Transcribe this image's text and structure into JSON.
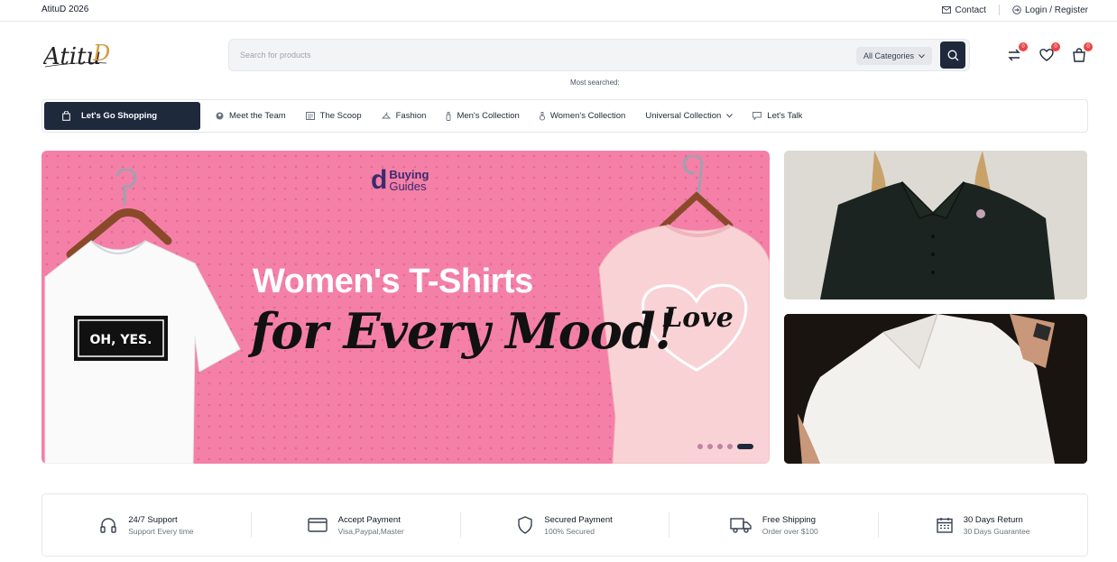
{
  "topbar": {
    "brand": "AtituD 2026",
    "contact": "Contact",
    "login": "Login / Register"
  },
  "header": {
    "logo_text": "AtituD",
    "search_placeholder": "Search for products",
    "category_select": "All Categories",
    "most_searched": "Most searched:",
    "compare_count": "0",
    "wishlist_count": "0",
    "cart_count": "0"
  },
  "nav": {
    "shop_button": "Let's Go Shopping",
    "items": [
      {
        "label": "Meet the Team",
        "icon": "team-icon"
      },
      {
        "label": "The Scoop",
        "icon": "news-icon"
      },
      {
        "label": "Fashion",
        "icon": "hanger-icon"
      },
      {
        "label": "Men's Collection",
        "icon": "bottle-icon"
      },
      {
        "label": "Women's Collection",
        "icon": "perfume-icon"
      },
      {
        "label": "Universal Collection",
        "icon": "chevron-down-icon"
      },
      {
        "label": "Let's Talk",
        "icon": "chat-icon"
      }
    ]
  },
  "hero": {
    "logo_letter": "d",
    "logo_word1": "Buying",
    "logo_word2": "Guides",
    "headline": "Women's T-Shirts",
    "subheadline": "for Every Mood!",
    "shirt_left_text": "OH, YES.",
    "shirt_right_text": "Love",
    "active_slide": 5,
    "slide_count": 5
  },
  "features": [
    {
      "title": "24/7 Support",
      "subtitle": "Support Every time",
      "icon": "headphones-icon"
    },
    {
      "title": "Accept Payment",
      "subtitle": "Visa,Paypal,Master",
      "icon": "credit-card-icon"
    },
    {
      "title": "Secured Payment",
      "subtitle": "100% Secured",
      "icon": "shield-icon"
    },
    {
      "title": "Free Shipping",
      "subtitle": "Order over $100",
      "icon": "truck-icon"
    },
    {
      "title": "30 Days Return",
      "subtitle": "30 Days Guarantee",
      "icon": "calendar-icon"
    }
  ],
  "colors": {
    "primary": "#1e293b",
    "hero_pink": "#f480a8",
    "badge": "#ef4444"
  }
}
